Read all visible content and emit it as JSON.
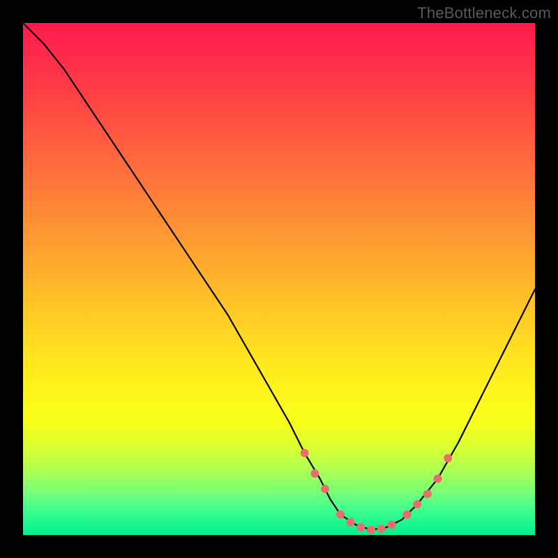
{
  "watermark_text": "TheBottleneck.com",
  "chart_data": {
    "type": "line",
    "title": "",
    "xlabel": "",
    "ylabel": "",
    "xlim": [
      0,
      100
    ],
    "ylim": [
      0,
      100
    ],
    "curve": {
      "x": [
        0,
        4,
        8,
        12,
        16,
        20,
        24,
        28,
        32,
        36,
        40,
        44,
        48,
        52,
        55,
        58,
        60,
        62,
        65,
        68,
        71,
        74,
        77,
        81,
        85,
        89,
        93,
        97,
        100
      ],
      "y": [
        100,
        96,
        91,
        85,
        79,
        73,
        67,
        61,
        55,
        49,
        43,
        36,
        29,
        22,
        16,
        11,
        7,
        4,
        2,
        1.0,
        1.5,
        3,
        6,
        11,
        18,
        26,
        34,
        42,
        48
      ]
    },
    "markers": {
      "x": [
        55,
        57,
        59,
        62,
        64,
        66,
        68,
        70,
        72,
        75,
        77,
        79,
        81,
        83
      ],
      "y": [
        16,
        12,
        9,
        4,
        2.5,
        1.5,
        1.0,
        1.2,
        2.0,
        4,
        6,
        8,
        11,
        15
      ],
      "color": "#e96f6f",
      "radius": 6
    },
    "background_gradient": {
      "top": "#ff1a4d",
      "bottom": "#00f090"
    }
  }
}
